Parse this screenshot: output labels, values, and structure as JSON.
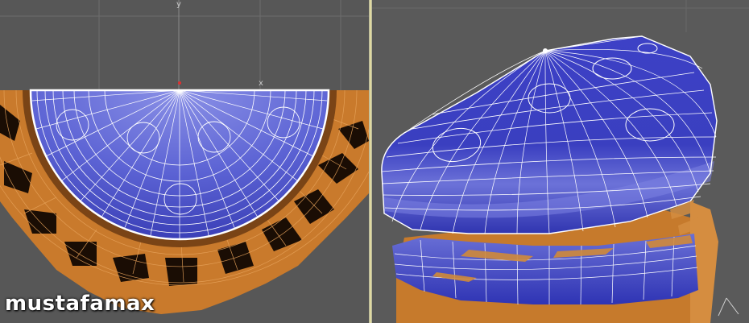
{
  "watermark": {
    "text": "mustafamax"
  },
  "viewports": {
    "left": {
      "axis_y": "y",
      "axis_x": "x"
    },
    "right": {}
  },
  "colors": {
    "background": "#575757",
    "grid": "#6a6a6a",
    "mesh_face": "#3a3fc4",
    "mesh_highlight": "#7d84e0",
    "mesh_wire": "#ffffff",
    "orange": "#d48a3a",
    "orange_dark": "#6b3a10",
    "divider": "#e0d9a0"
  }
}
